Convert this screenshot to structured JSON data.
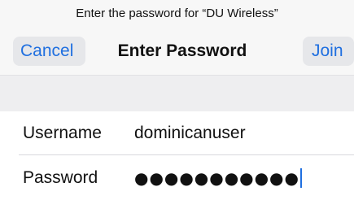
{
  "prompt": "Enter the password for “DU Wireless”",
  "nav": {
    "cancel_label": "Cancel",
    "title": "Enter Password",
    "join_label": "Join"
  },
  "form": {
    "username_label": "Username",
    "username_value": "dominicanuser",
    "password_label": "Password",
    "password_mask": "●●●●●●●●●●●"
  },
  "colors": {
    "accent": "#1f6fe0",
    "button_bg": "#e6e7ea",
    "header_bg": "#f7f7f7",
    "section_gap": "#eeeef0"
  }
}
